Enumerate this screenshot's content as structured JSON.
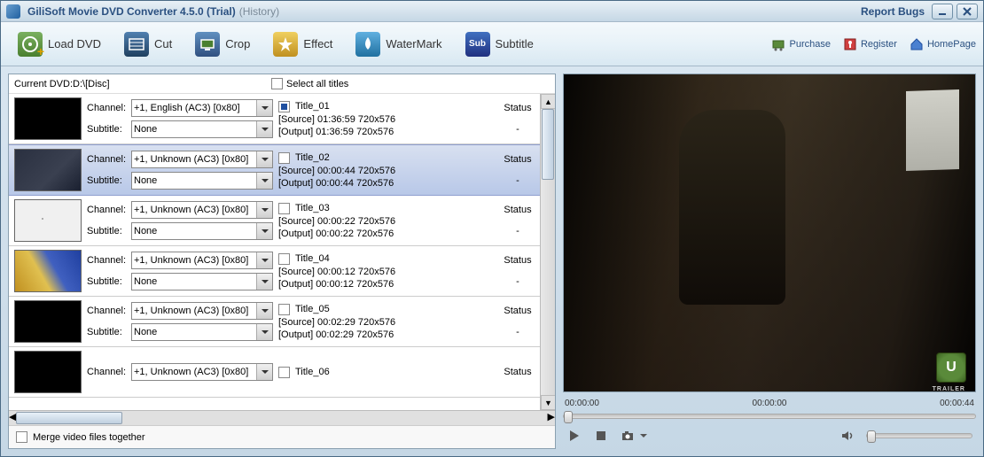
{
  "titlebar": {
    "title": "GiliSoft Movie DVD Converter 4.5.0 (Trial)",
    "history": "(History)",
    "report": "Report Bugs"
  },
  "toolbar": {
    "load": "Load DVD",
    "cut": "Cut",
    "crop": "Crop",
    "effect": "Effect",
    "watermark": "WaterMark",
    "subtitle": "Subtitle",
    "sub_label": "Sub"
  },
  "links": {
    "purchase": "Purchase",
    "register": "Register",
    "homepage": "HomePage"
  },
  "header": {
    "current_dvd": "Current DVD:D:\\[Disc]",
    "select_all": "Select all titles"
  },
  "labels": {
    "channel": "Channel:",
    "subtitle": "Subtitle:",
    "source": "[Source]",
    "output": "[Output]",
    "status": "Status",
    "merge": "Merge video files together",
    "rating": "U",
    "trailer": "TRAILER"
  },
  "titles": [
    {
      "name": "Title_01",
      "checked": true,
      "channel": "+1, English (AC3) [0x80]",
      "subtitle": "None",
      "src_time": "01:36:59",
      "src_res": "720x576",
      "out_time": "01:36:59",
      "out_res": "720x576",
      "status": "-",
      "thumb": "t1"
    },
    {
      "name": "Title_02",
      "checked": false,
      "channel": "+1, Unknown (AC3) [0x80]",
      "subtitle": "None",
      "src_time": "00:00:44",
      "src_res": "720x576",
      "out_time": "00:00:44",
      "out_res": "720x576",
      "status": "-",
      "thumb": "t2",
      "selected": true
    },
    {
      "name": "Title_03",
      "checked": false,
      "channel": "+1, Unknown (AC3) [0x80]",
      "subtitle": "None",
      "src_time": "00:00:22",
      "src_res": "720x576",
      "out_time": "00:00:22",
      "out_res": "720x576",
      "status": "-",
      "thumb": "t3"
    },
    {
      "name": "Title_04",
      "checked": false,
      "channel": "+1, Unknown (AC3) [0x80]",
      "subtitle": "None",
      "src_time": "00:00:12",
      "src_res": "720x576",
      "out_time": "00:00:12",
      "out_res": "720x576",
      "status": "-",
      "thumb": "t4"
    },
    {
      "name": "Title_05",
      "checked": false,
      "channel": "+1, Unknown (AC3) [0x80]",
      "subtitle": "None",
      "src_time": "00:02:29",
      "src_res": "720x576",
      "out_time": "00:02:29",
      "out_res": "720x576",
      "status": "-",
      "thumb": "t1"
    },
    {
      "name": "Title_06",
      "checked": false,
      "channel": "+1, Unknown (AC3) [0x80]",
      "subtitle": "",
      "src_time": "",
      "src_res": "",
      "out_time": "",
      "out_res": "",
      "status": "",
      "thumb": "t1",
      "partial": true
    }
  ],
  "preview": {
    "time_start": "00:00:00",
    "time_mid": "00:00:00",
    "time_end": "00:00:44"
  }
}
